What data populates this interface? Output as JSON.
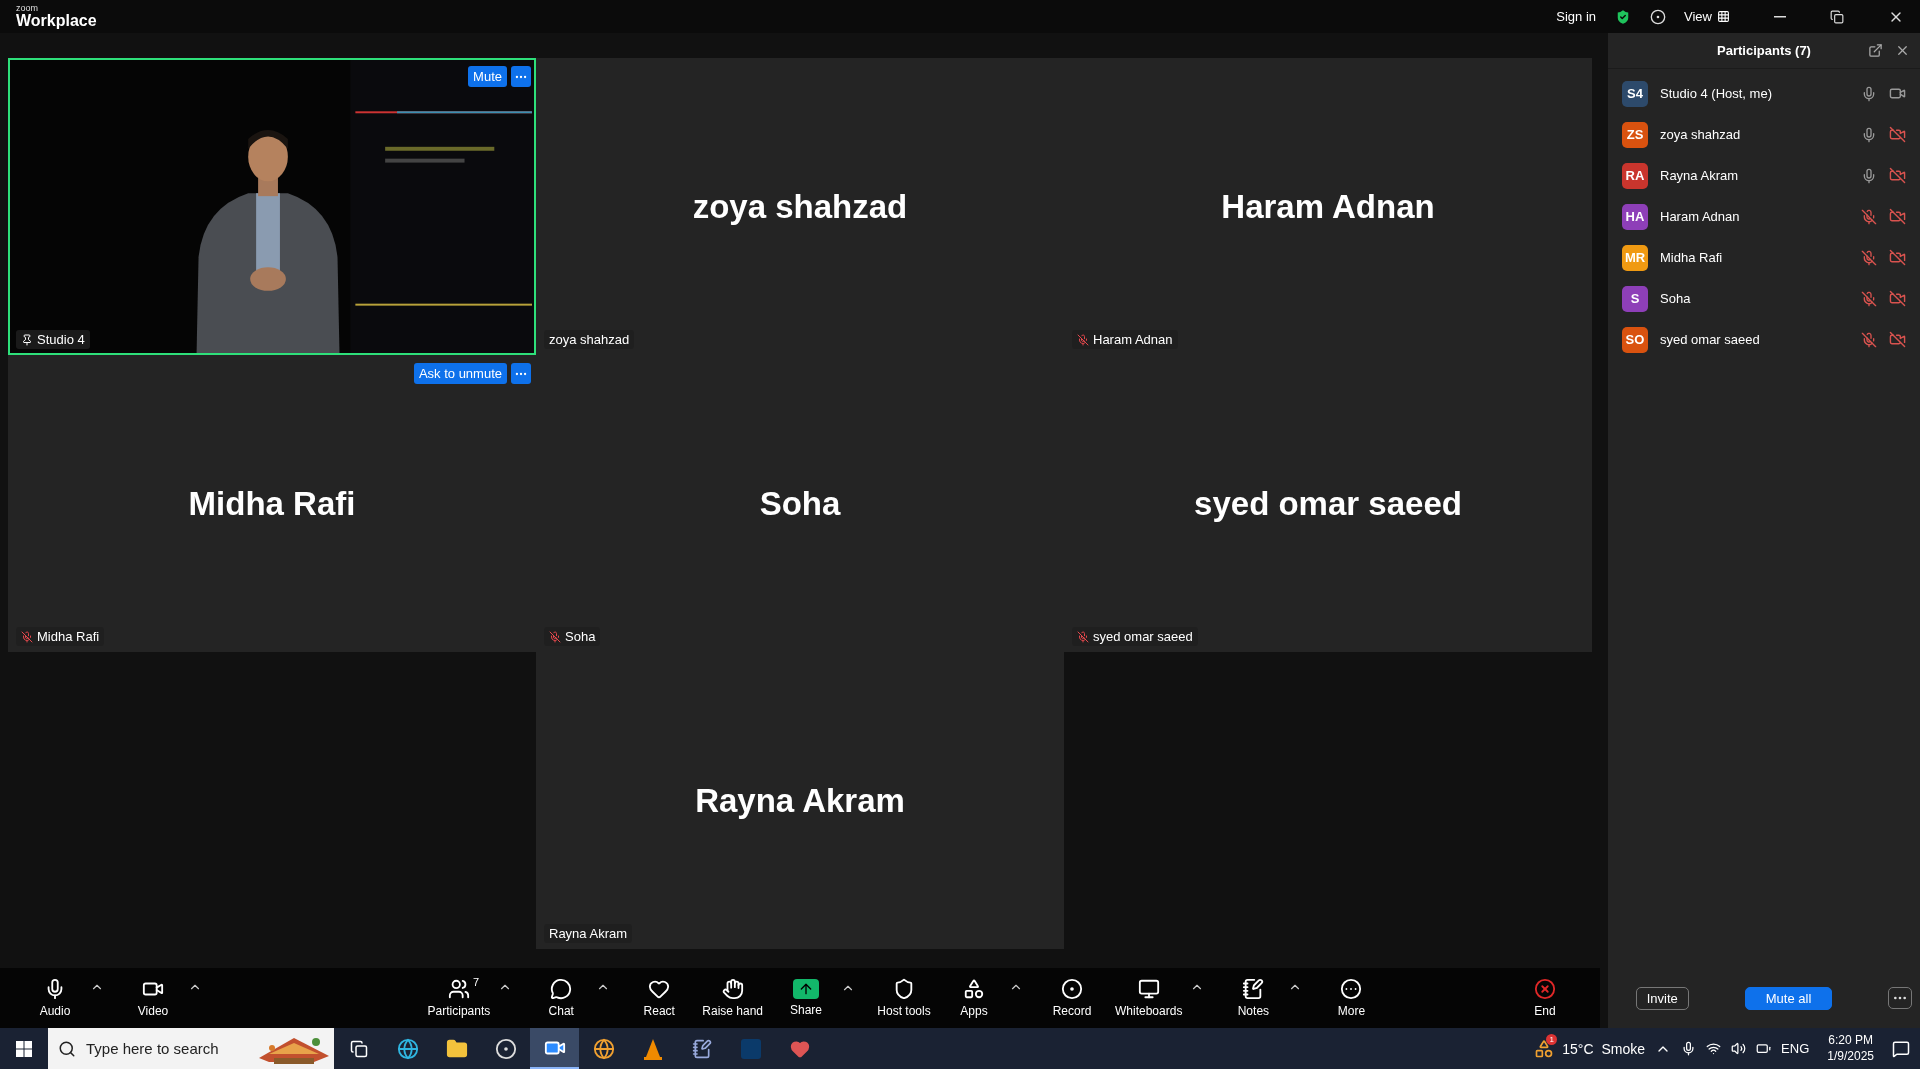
{
  "titlebar": {
    "logo_small": "zoom",
    "logo": "Workplace",
    "sign_in": "Sign in",
    "view": "View"
  },
  "tiles": [
    {
      "kind": "video",
      "label": "Studio 4",
      "speaking": true,
      "muted": false,
      "overlay_button": "Mute"
    },
    {
      "kind": "name",
      "display_name": "zoya shahzad",
      "label": "zoya shahzad",
      "speaking": false,
      "muted": false
    },
    {
      "kind": "name",
      "display_name": "Haram Adnan",
      "label": "Haram Adnan",
      "speaking": false,
      "muted": true
    },
    {
      "kind": "name",
      "display_name": "Midha Rafi",
      "label": "Midha Rafi",
      "speaking": false,
      "muted": true,
      "overlay_button": "Ask to unmute"
    },
    {
      "kind": "name",
      "display_name": "Soha",
      "label": "Soha",
      "speaking": false,
      "muted": true
    },
    {
      "kind": "name",
      "display_name": "syed omar saeed",
      "label": "syed omar saeed",
      "speaking": false,
      "muted": true
    },
    {
      "kind": "name",
      "display_name": "Rayna Akram",
      "label": "Rayna Akram",
      "speaking": false,
      "muted": false
    }
  ],
  "toolbar": {
    "left": [
      {
        "label": "Audio",
        "caret": true
      },
      {
        "label": "Video",
        "caret": true
      }
    ],
    "center": [
      {
        "label": "Participants",
        "caret": true,
        "badge": "7"
      },
      {
        "label": "Chat",
        "caret": true
      },
      {
        "label": "React",
        "caret": false
      },
      {
        "label": "Raise hand",
        "caret": false
      },
      {
        "label": "Share",
        "caret": true,
        "kind": "share"
      },
      {
        "label": "Host tools",
        "caret": false
      },
      {
        "label": "Apps",
        "caret": true
      },
      {
        "label": "Record",
        "caret": false
      },
      {
        "label": "Whiteboards",
        "caret": true
      },
      {
        "label": "Notes",
        "caret": true
      },
      {
        "label": "More",
        "caret": false
      }
    ],
    "right": [
      {
        "label": "End",
        "caret": false,
        "kind": "end"
      }
    ]
  },
  "participants_panel": {
    "title": "Participants (7)",
    "participants": [
      {
        "initials": "S4",
        "name": "Studio 4 (Host, me)",
        "color": "#2d4a6b",
        "muted": false,
        "video_off": false
      },
      {
        "initials": "ZS",
        "name": "zoya shahzad",
        "color": "#d9520f",
        "muted": false,
        "video_off": true
      },
      {
        "initials": "RA",
        "name": "Rayna Akram",
        "color": "#c9352d",
        "muted": false,
        "video_off": true
      },
      {
        "initials": "HA",
        "name": "Haram Adnan",
        "color": "#8e3fb8",
        "muted": true,
        "video_off": true
      },
      {
        "initials": "MR",
        "name": "Midha Rafi",
        "color": "#f09a12",
        "muted": true,
        "video_off": true
      },
      {
        "initials": "S",
        "name": "Soha",
        "color": "#8e3fb8",
        "muted": true,
        "video_off": true
      },
      {
        "initials": "SO",
        "name": "syed omar saeed",
        "color": "#d9520f",
        "muted": true,
        "video_off": true
      }
    ],
    "buttons": [
      {
        "label": "Invite",
        "kind": "outline"
      },
      {
        "label": "Mute all",
        "kind": "primary"
      }
    ]
  },
  "taskbar": {
    "search_placeholder": "Type here to search",
    "weather_badge": "1",
    "temperature": "15°C",
    "weather": "Smoke",
    "language": "ENG",
    "time": "6:20 PM",
    "date": "1/9/2025"
  }
}
